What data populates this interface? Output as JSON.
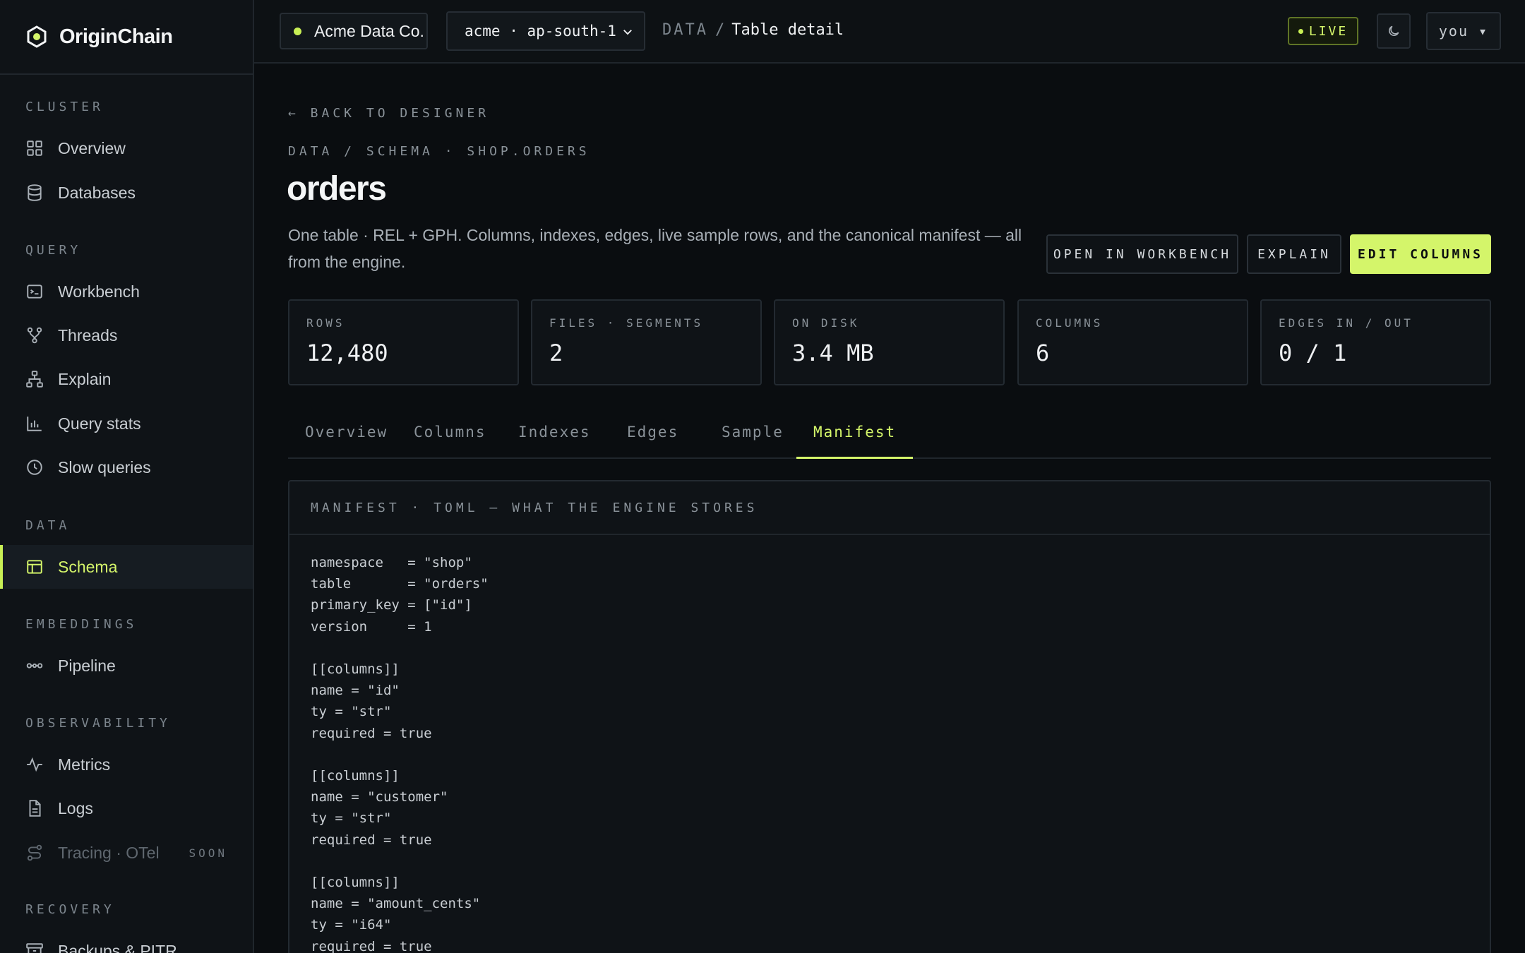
{
  "brand": {
    "name": "OriginChain"
  },
  "sidebar": {
    "sections": [
      {
        "label": "CLUSTER"
      },
      {
        "label": "QUERY"
      },
      {
        "label": "DATA"
      },
      {
        "label": "EMBEDDINGS"
      },
      {
        "label": "OBSERVABILITY"
      },
      {
        "label": "RECOVERY"
      }
    ],
    "items": [
      {
        "label": "Overview",
        "icon": "grid-icon"
      },
      {
        "label": "Databases",
        "icon": "database-icon"
      },
      {
        "label": "Workbench",
        "icon": "terminal-icon"
      },
      {
        "label": "Threads",
        "icon": "branch-icon"
      },
      {
        "label": "Explain",
        "icon": "tree-icon"
      },
      {
        "label": "Query stats",
        "icon": "bar-chart-icon"
      },
      {
        "label": "Slow queries",
        "icon": "clock-icon"
      },
      {
        "label": "Schema",
        "icon": "table-icon",
        "active": true
      },
      {
        "label": "Pipeline",
        "icon": "pipeline-icon"
      },
      {
        "label": "Metrics",
        "icon": "pulse-icon"
      },
      {
        "label": "Logs",
        "icon": "file-icon"
      },
      {
        "label": "Tracing · OTel",
        "icon": "route-icon",
        "badge": "SOON"
      },
      {
        "label": "Backups & PITR",
        "icon": "archive-icon"
      }
    ]
  },
  "topbar": {
    "org": "Acme Data Co.",
    "region": "acme · ap-south-1",
    "crumb_section": "DATA",
    "crumb_page": "Table detail",
    "live": "LIVE",
    "user": "you ▾"
  },
  "page": {
    "back": "← BACK TO DESIGNER",
    "eyebrow": "DATA / SCHEMA · SHOP.ORDERS",
    "title": "orders",
    "description": "One table · REL + GPH. Columns, indexes, edges, live sample rows, and the canonical manifest — all from the engine.",
    "actions": {
      "workbench": "OPEN IN WORKBENCH",
      "explain": "EXPLAIN",
      "edit": "EDIT COLUMNS"
    }
  },
  "stats": [
    {
      "label": "ROWS",
      "value": "12,480"
    },
    {
      "label": "FILES · SEGMENTS",
      "value": "2"
    },
    {
      "label": "ON DISK",
      "value": "3.4 MB"
    },
    {
      "label": "COLUMNS",
      "value": "6"
    },
    {
      "label": "EDGES IN / OUT",
      "value": "0 / 1"
    }
  ],
  "tabs": [
    {
      "label": "Overview"
    },
    {
      "label": "Columns"
    },
    {
      "label": "Indexes"
    },
    {
      "label": "Edges"
    },
    {
      "label": "Sample"
    },
    {
      "label": "Manifest",
      "active": true
    }
  ],
  "manifest": {
    "header": "MANIFEST · TOML — WHAT THE ENGINE STORES",
    "content": "namespace   = \"shop\"\ntable       = \"orders\"\nprimary_key = [\"id\"]\nversion     = 1\n\n[[columns]]\nname = \"id\"\nty = \"str\"\nrequired = true\n\n[[columns]]\nname = \"customer\"\nty = \"str\"\nrequired = true\n\n[[columns]]\nname = \"amount_cents\"\nty = \"i64\"\nrequired = true"
  },
  "colors": {
    "accent": "#d4f56a",
    "background": "#0a0d10",
    "surface": "#0f1317"
  }
}
